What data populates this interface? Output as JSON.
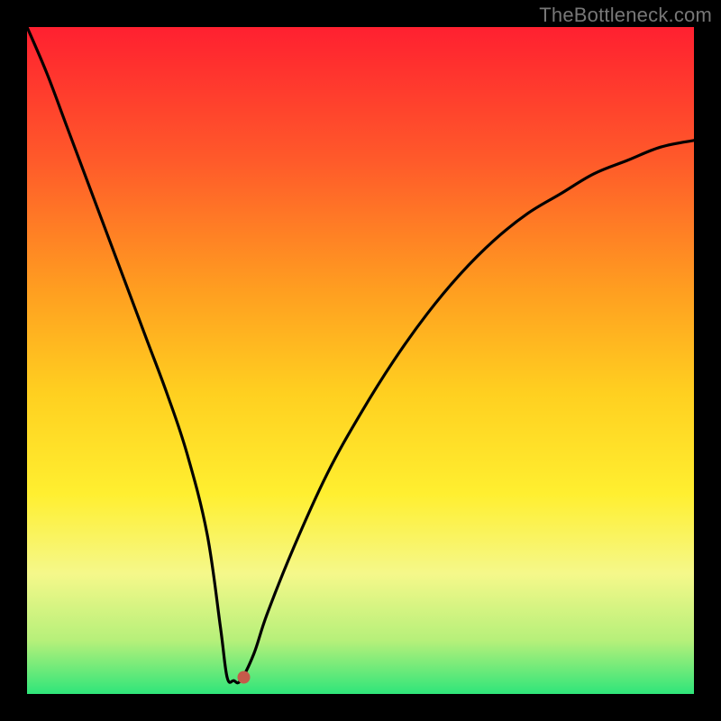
{
  "attribution": "TheBottleneck.com",
  "chart_data": {
    "type": "line",
    "title": "",
    "xlabel": "",
    "ylabel": "",
    "xlim": [
      0,
      100
    ],
    "ylim": [
      0,
      100
    ],
    "grid": false,
    "background_gradient_stops": [
      {
        "offset": 0,
        "color": "#ff2030"
      },
      {
        "offset": 20,
        "color": "#ff5a2a"
      },
      {
        "offset": 40,
        "color": "#ffa020"
      },
      {
        "offset": 55,
        "color": "#ffd020"
      },
      {
        "offset": 70,
        "color": "#ffef30"
      },
      {
        "offset": 82,
        "color": "#f5f88a"
      },
      {
        "offset": 92,
        "color": "#b6f07a"
      },
      {
        "offset": 100,
        "color": "#2fe57a"
      }
    ],
    "series": [
      {
        "name": "bottleneck-curve",
        "kind": "line",
        "color": "#000000",
        "x": [
          0,
          3,
          6,
          9,
          12,
          15,
          18,
          21,
          24,
          27,
          29,
          30,
          31,
          32,
          34,
          36,
          40,
          45,
          50,
          55,
          60,
          65,
          70,
          75,
          80,
          85,
          90,
          95,
          100
        ],
        "y": [
          100,
          93,
          85,
          77,
          69,
          61,
          53,
          45,
          36,
          24,
          10,
          2.5,
          2.0,
          2.0,
          6,
          12,
          22,
          33,
          42,
          50,
          57,
          63,
          68,
          72,
          75,
          78,
          80,
          82,
          83
        ]
      }
    ],
    "markers": [
      {
        "name": "optimum-point",
        "x": 32.5,
        "y": 2.5,
        "color": "#c55a4a",
        "radius": 7
      }
    ]
  }
}
